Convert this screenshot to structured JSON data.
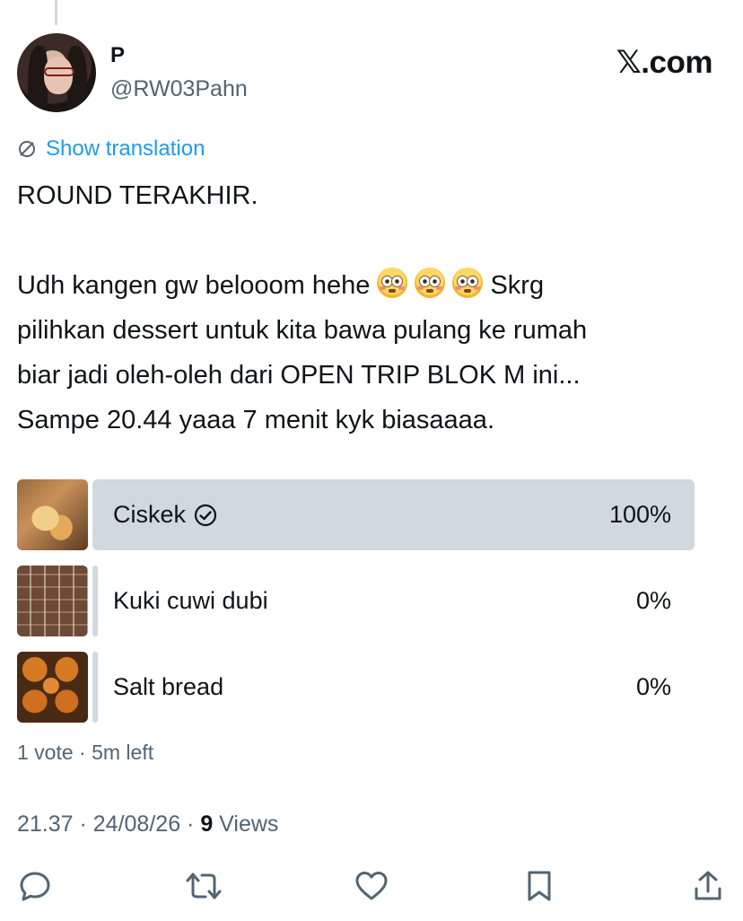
{
  "author": {
    "display_name": "P",
    "handle": "@RW03Pahn"
  },
  "brand": "𝕏.com",
  "translate_label": "Show translation",
  "tweet": {
    "line1": "ROUND TERAKHIR.",
    "line2a": "Udh kangen gw belooom hehe ",
    "line2b": "Skrg",
    "line3": "pilihkan dessert untuk kita bawa pulang ke rumah",
    "line4": "biar jadi oleh-oleh dari OPEN TRIP BLOK M ini...",
    "line5": "Sampe 20.44 yaaa 7 menit kyk biasaaaa.",
    "emoji_name": "flushed-face-emoji"
  },
  "poll": {
    "options": [
      {
        "label": "Ciskek",
        "percent": "100%",
        "value": 100,
        "selected": true
      },
      {
        "label": "Kuki cuwi dubi",
        "percent": "0%",
        "value": 0,
        "selected": false
      },
      {
        "label": "Salt bread",
        "percent": "0%",
        "value": 0,
        "selected": false
      }
    ],
    "meta": "1 vote · 5m left"
  },
  "meta": {
    "time_date": "21.37 · 24/08/26 · ",
    "views_count": "9",
    "views_label": " Views"
  },
  "actions": [
    "reply-icon",
    "retweet-icon",
    "like-icon",
    "bookmark-icon",
    "share-icon"
  ],
  "colors": {
    "accent": "#1d9bf0",
    "muted": "#536471",
    "poll_bar": "#cfd9de"
  }
}
